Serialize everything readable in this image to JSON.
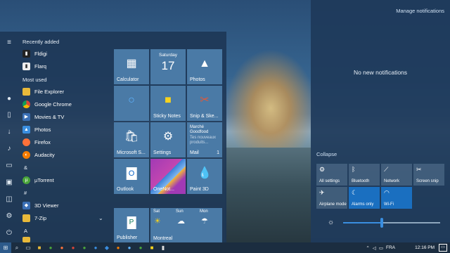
{
  "start_menu": {
    "recently_added_label": "Recently added",
    "recent_apps": [
      "Fldigi",
      "Flarq"
    ],
    "most_used_label": "Most used",
    "most_used_apps": [
      "File Explorer",
      "Google Chrome",
      "Movies & TV",
      "Photos",
      "Firefox",
      "Audacity"
    ],
    "section_ampersand": "&",
    "section_hash": "#",
    "section_a": "A",
    "apps_more": [
      "µTorrent",
      "3D Viewer",
      "7-Zip"
    ],
    "tiles": {
      "calculator": "Calculator",
      "calendar_day": "Saturday",
      "calendar_date": "17",
      "photos": "Photos",
      "sticky_notes": "Sticky Notes",
      "snip_sketch": "Snip & Ske...",
      "microsoft_store": "Microsoft S...",
      "settings": "Settings",
      "mail_sender": "Marché Goodfood",
      "mail_preview": "Tes nouveaux produits...",
      "mail_label": "Mail",
      "mail_count": "1",
      "outlook": "Outlook",
      "onenote": "OneNot...",
      "paint3d": "Paint 3D",
      "publisher": "Publisher",
      "weather_days": [
        "Sat",
        "Sun",
        "Mon"
      ],
      "weather_city": "Montreal"
    }
  },
  "action_center": {
    "manage": "Manage notifications",
    "no_notifications": "No new notifications",
    "collapse": "Collapse",
    "brightness_level": 0.4,
    "quick_actions": [
      {
        "label": "All settings",
        "icon": "gear-icon",
        "on": false
      },
      {
        "label": "Bluetooth",
        "icon": "bluetooth-icon",
        "on": false
      },
      {
        "label": "Network",
        "icon": "network-icon",
        "on": false
      },
      {
        "label": "Screen snip",
        "icon": "snip-icon",
        "on": false
      },
      {
        "label": "Airplane mode",
        "icon": "airplane-icon",
        "on": false
      },
      {
        "label": "Alarms only",
        "icon": "moon-icon",
        "on": true
      },
      {
        "label": "Wi-Fi",
        "icon": "wifi-icon",
        "on": true
      }
    ]
  },
  "taskbar": {
    "language": "FRA",
    "time": "12:16 PM"
  }
}
